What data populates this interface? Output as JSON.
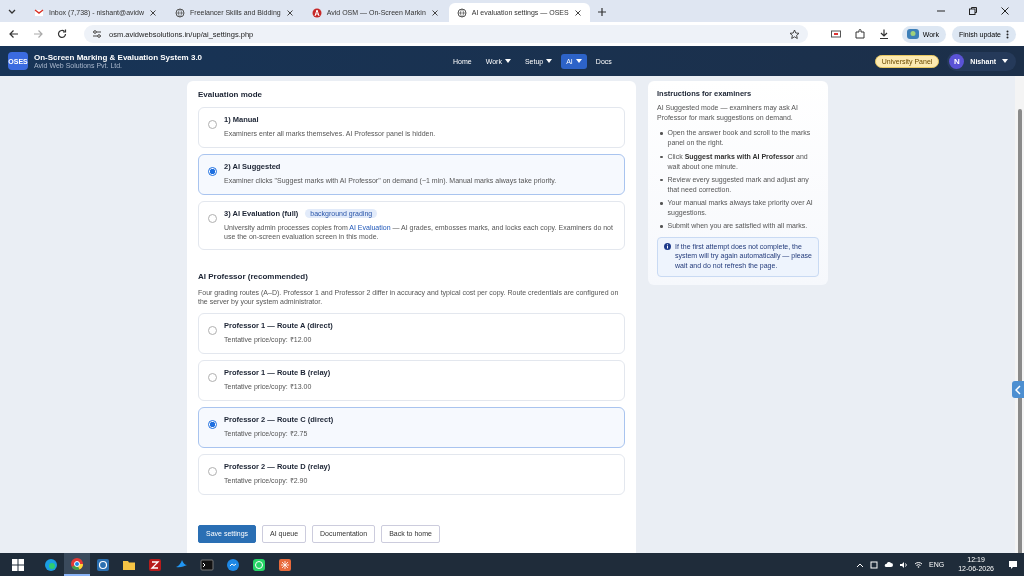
{
  "browser": {
    "tabs": [
      {
        "title": "Inbox (7,738) - nishant@avidw",
        "kind": "mail",
        "selected": false
      },
      {
        "title": "Freelancer Skills and Bidding",
        "kind": "globe",
        "selected": false
      },
      {
        "title": "Avid OSM — On-Screen Markin",
        "kind": "letter",
        "selected": false
      },
      {
        "title": "AI evaluation settings — OSES",
        "kind": "globe",
        "selected": true
      }
    ],
    "url": "osm.avidwebsolutions.in/up/ai_settings.php",
    "profile": "Work",
    "update": "Finish update"
  },
  "app": {
    "logo": "OSES",
    "title": "On-Screen Marking & Evaluation System 3.0",
    "subtitle": "Avid Web Solutions Pvt. Ltd.",
    "nav": [
      {
        "label": "Home",
        "dropdown": false,
        "selected": false
      },
      {
        "label": "Work",
        "dropdown": true,
        "selected": false
      },
      {
        "label": "Setup",
        "dropdown": true,
        "selected": false
      },
      {
        "label": "AI",
        "dropdown": true,
        "selected": true
      },
      {
        "label": "Docs",
        "dropdown": false,
        "selected": false
      }
    ],
    "panel_badge": "University Panel",
    "user": {
      "initial": "N",
      "name": "Nishant"
    }
  },
  "evaluation_mode": {
    "title": "Evaluation mode",
    "options": [
      {
        "title": "1) Manual",
        "description": {
          "before": "Examiners enter all marks themselves. AI Professor panel is hidden."
        },
        "selected": false
      },
      {
        "title": "2) AI Suggested",
        "description": {
          "before": "Examiner clicks \"Suggest marks with AI Professor\" on demand (~1 min). Manual marks always take priority."
        },
        "selected": true
      },
      {
        "title": "3) AI Evaluation (full)",
        "badge": "background grading",
        "description": {
          "before": "University admin processes copies from ",
          "link": "AI Evaluation",
          "after": " — AI grades, embosses marks, and locks each copy. Examiners do not use the on-screen evaluation screen in this mode."
        },
        "selected": false
      }
    ]
  },
  "ai_professor": {
    "title": "AI Professor (recommended)",
    "description": "Four grading routes (A–D). Professor 1 and Professor 2 differ in accuracy and typical cost per copy. Route credentials are configured on the server by your system administrator.",
    "options": [
      {
        "title": "Professor 1 — Route A (direct)",
        "price": "Tentative price/copy: ₹12.00",
        "selected": false
      },
      {
        "title": "Professor 1 — Route B (relay)",
        "price": "Tentative price/copy: ₹13.00",
        "selected": false
      },
      {
        "title": "Professor 2 — Route C (direct)",
        "price": "Tentative price/copy: ₹2.75",
        "selected": true
      },
      {
        "title": "Professor 2 — Route D (relay)",
        "price": "Tentative price/copy: ₹2.90",
        "selected": false
      }
    ]
  },
  "buttons": [
    {
      "label": "Save settings",
      "kind": "primary"
    },
    {
      "label": "AI queue",
      "kind": "secondary"
    },
    {
      "label": "Documentation",
      "kind": "secondary"
    },
    {
      "label": "Back to home",
      "kind": "secondary"
    }
  ],
  "instructions": {
    "title": "Instructions for examiners",
    "intro": "AI Suggested mode — examiners may ask AI Professor for mark suggestions on demand.",
    "items": [
      "Open the answer book and scroll to the marks panel on the right.",
      "Click **Suggest marks with AI Professor** and wait about one minute.",
      "Review every suggested mark and adjust any that need correction.",
      "Your manual marks always take priority over AI suggestions.",
      "Submit when you are satisfied with all marks."
    ],
    "note": "If the first attempt does not complete, the system will try again automatically — please wait and do not refresh the page."
  },
  "taskbar": {
    "apps": [
      {
        "kind": "edge",
        "selected": false
      },
      {
        "kind": "chrome",
        "selected": true
      },
      {
        "kind": "app",
        "selected": false
      },
      {
        "kind": "folder",
        "selected": false
      },
      {
        "kind": "filezilla",
        "selected": false
      },
      {
        "kind": "bird",
        "selected": false
      },
      {
        "kind": "terminal",
        "selected": false
      },
      {
        "kind": "messenger",
        "selected": false
      },
      {
        "kind": "whatsapp",
        "selected": false
      },
      {
        "kind": "spark",
        "selected": false
      }
    ],
    "language": "ENG",
    "time": "12:19",
    "date": "12-06-2026"
  }
}
